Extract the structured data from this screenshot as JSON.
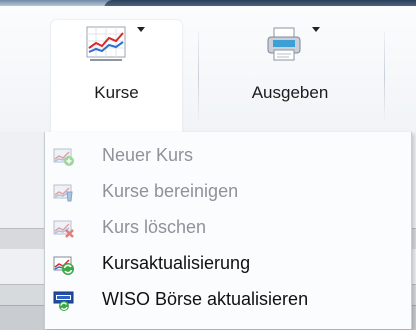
{
  "ribbon": {
    "kurse_label": "Kurse",
    "ausgeben_label": "Ausgeben"
  },
  "menu": {
    "items": [
      {
        "label": "Neuer Kurs",
        "enabled": false,
        "icon": "chart-add-icon"
      },
      {
        "label": "Kurse bereinigen",
        "enabled": false,
        "icon": "chart-clean-icon"
      },
      {
        "label": "Kurs löschen",
        "enabled": false,
        "icon": "chart-delete-icon"
      },
      {
        "label": "Kursaktualisierung",
        "enabled": true,
        "icon": "chart-refresh-icon"
      },
      {
        "label": "WISO Börse aktualisieren",
        "enabled": true,
        "icon": "wiso-refresh-icon"
      }
    ]
  },
  "colors": {
    "accent_dark": "#2a3f5a",
    "disabled_text": "#8d9399",
    "enabled_text": "#111111"
  }
}
